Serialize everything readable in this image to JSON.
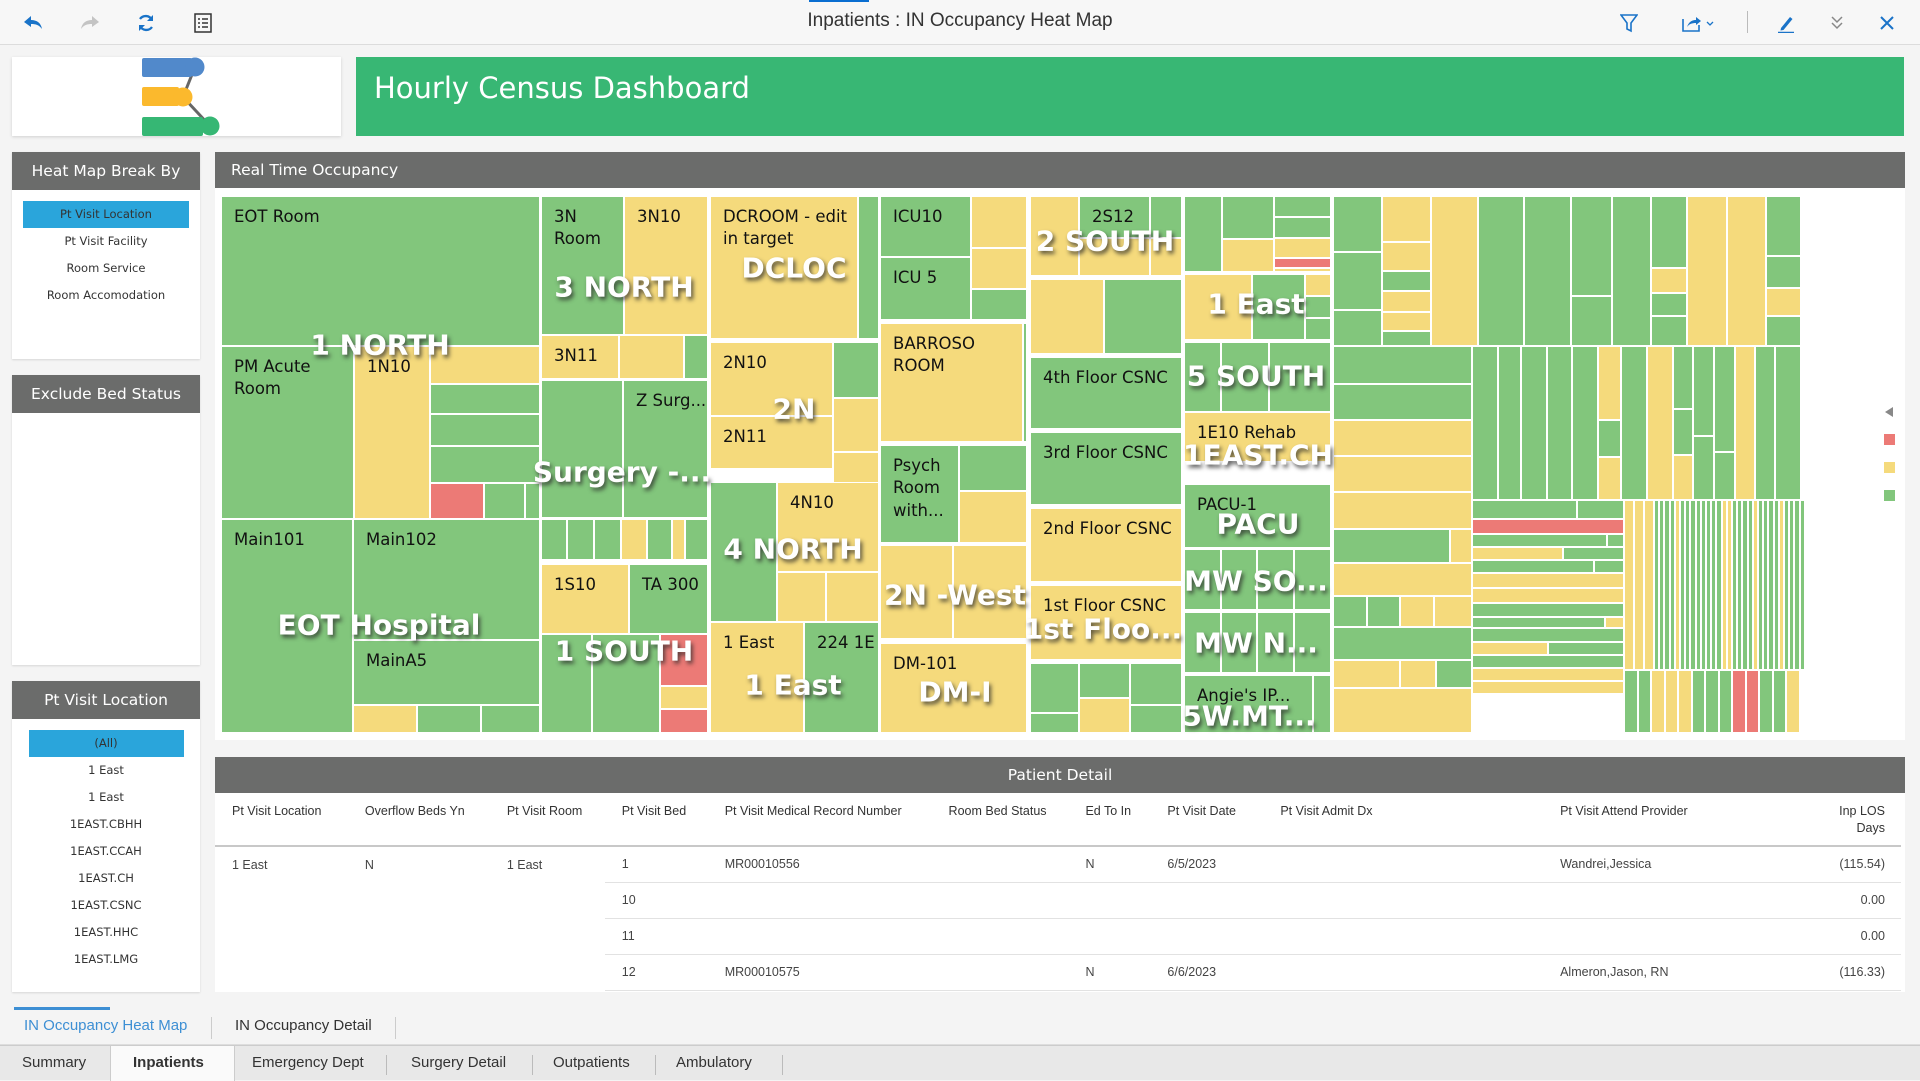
{
  "window": {
    "title": "Inpatients : IN Occupancy Heat Map",
    "toolbar_left": [
      "undo-icon",
      "redo-icon",
      "refresh-icon",
      "list-view-icon"
    ],
    "toolbar_right": [
      "filter-icon",
      "share-icon",
      "edit-icon",
      "collapse-icon",
      "close-icon"
    ]
  },
  "banner": {
    "title": "Hourly Census Dashboard",
    "color": "#38b774"
  },
  "heatmap_break_by": {
    "header": "Heat Map Break By",
    "items": [
      "Pt Visit Location",
      "Pt Visit Facility",
      "Room Service",
      "Room Accomodation"
    ],
    "selected": "Pt Visit Location"
  },
  "exclude_bed_status": {
    "header": "Exclude Bed Status"
  },
  "pt_visit_location": {
    "header": "Pt Visit Location",
    "items": [
      "(All)",
      "1 East",
      "1 East",
      "1EAST.CBHH",
      "1EAST.CCAH",
      "1EAST.CH",
      "1EAST.CSNC",
      "1EAST.HHC",
      "1EAST.LMG"
    ],
    "selected": "(All)"
  },
  "heatmap": {
    "header": "Real Time Occupancy",
    "status_colors": {
      "red": "#ec7a76",
      "yellow": "#f5da7c",
      "green": "#82c67c"
    },
    "legend": [
      "red",
      "yellow",
      "green"
    ],
    "group_labels": [
      "1 NORTH",
      "3 NORTH",
      "DCLOC",
      "2 SOUTH",
      "1 East",
      "5 SOUTH",
      "1EAST.CH",
      "PACU",
      "MW SO...",
      "MW N...",
      "5W.MT...",
      "Surgery -...",
      "2N",
      "4 NORTH",
      "2N -West",
      "1st Floo...",
      "EOT Hospital",
      "1 SOUTH",
      "1 East",
      "DM-I"
    ],
    "room_labels": [
      "EOT Room",
      "PM Acute Room",
      "1N10",
      "3N Room",
      "3N10",
      "3N11",
      "Z Surg...",
      "DCROOM - edit in target",
      "2N10",
      "2N11",
      "4N10",
      "1 East",
      "224 1E",
      "ICU10",
      "ICU 5",
      "BARROSO ROOM",
      "Psych Room with...",
      "DM-101",
      "2S12",
      "4th Floor CSNC",
      "3rd Floor CSNC",
      "2nd Floor CSNC",
      "1st Floor CSNC",
      "1E10 Rehab",
      "PACU-1",
      "Angie's IP...",
      "Main101",
      "Main102",
      "MainA5",
      "1S10",
      "TA 300"
    ]
  },
  "patient_detail": {
    "header": "Patient Detail",
    "columns": [
      "Pt Visit Location",
      "Overflow Beds Yn",
      "Pt Visit Room",
      "Pt Visit Bed",
      "Pt Visit Medical Record Number",
      "Room Bed Status",
      "Ed To In",
      "Pt Visit Date",
      "Pt Visit Admit Dx",
      "Pt Visit Attend Provider",
      "Inp LOS Days"
    ],
    "group": {
      "location": "1 East",
      "overflow": "N",
      "room": "1 East"
    },
    "rows": [
      {
        "bed": "1",
        "mrn": "MR00010556",
        "status": "",
        "ed_to_in": "N",
        "date": "6/5/2023",
        "dx": "",
        "provider": "Wandrei,Jessica",
        "los": "(115.54)"
      },
      {
        "bed": "10",
        "mrn": "",
        "status": "",
        "ed_to_in": "",
        "date": "",
        "dx": "",
        "provider": "",
        "los": "0.00"
      },
      {
        "bed": "11",
        "mrn": "",
        "status": "",
        "ed_to_in": "",
        "date": "",
        "dx": "",
        "provider": "",
        "los": "0.00"
      },
      {
        "bed": "12",
        "mrn": "MR00010575",
        "status": "",
        "ed_to_in": "N",
        "date": "6/6/2023",
        "dx": "",
        "provider": "Almeron,Jason, RN",
        "los": "(116.33)"
      }
    ]
  },
  "sub_tabs": {
    "items": [
      "IN Occupancy Heat Map",
      "IN Occupancy Detail"
    ],
    "active": "IN Occupancy Heat Map"
  },
  "tabs": {
    "items": [
      "Summary",
      "Inpatients",
      "Emergency Dept",
      "Surgery Detail",
      "Outpatients",
      "Ambulatory"
    ],
    "active": "Inpatients"
  }
}
